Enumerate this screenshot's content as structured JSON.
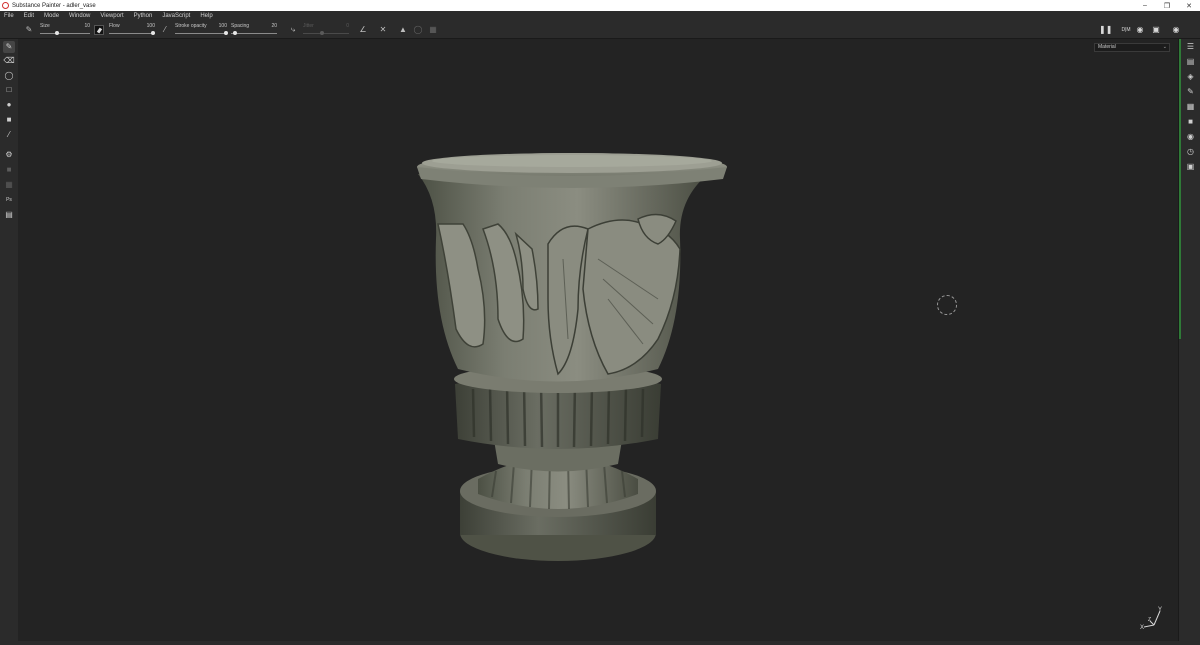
{
  "window": {
    "title": "Substance Painter - adler_vase"
  },
  "menu": [
    "File",
    "Edit",
    "Mode",
    "Window",
    "Viewport",
    "Python",
    "JavaScript",
    "Help"
  ],
  "toolbar": {
    "size": {
      "label": "Size",
      "value": "10"
    },
    "flow": {
      "label": "Flow",
      "value": "100"
    },
    "stroke_opacity": {
      "label": "Stroke opacity",
      "value": "100"
    },
    "spacing": {
      "label": "Spacing",
      "value": "20"
    },
    "jitter": {
      "label": "Jitter",
      "value": "0"
    }
  },
  "viewport": {
    "mode_label": "Material",
    "axis_x": "X",
    "axis_y": "Y",
    "axis_z": "Z"
  },
  "colors": {
    "accent": "#2f7a37",
    "app_icon": "#d23030"
  }
}
